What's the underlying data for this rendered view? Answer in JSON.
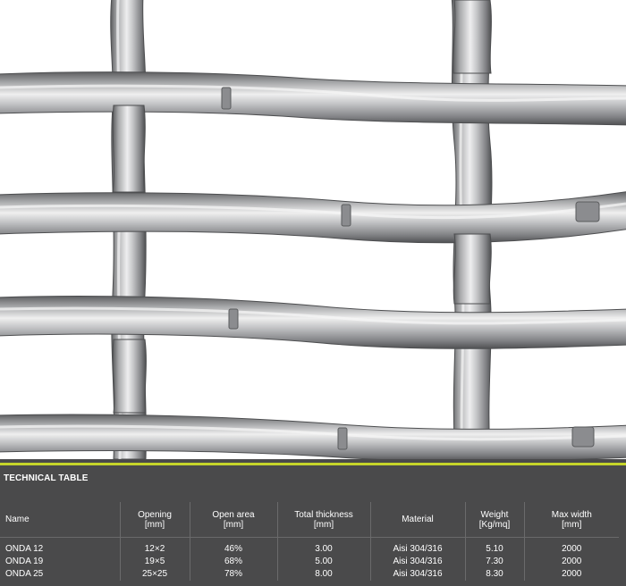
{
  "colors": {
    "panel_background": "#4a4a4b",
    "accent": "#c6d52a",
    "table_text": "#ffffff",
    "photo_background": "#ffffff",
    "wire_metal": "#b8b9bb"
  },
  "photo": {
    "subject": "crimped-wire-mesh-photo"
  },
  "table": {
    "title": "TECHNICAL TABLE",
    "headers": [
      {
        "label": "Name",
        "unit": ""
      },
      {
        "label": "Opening",
        "unit": "[mm]"
      },
      {
        "label": "Open area",
        "unit": "[mm]"
      },
      {
        "label": "Total thickness",
        "unit": "[mm]"
      },
      {
        "label": "Material",
        "unit": ""
      },
      {
        "label": "Weight",
        "unit": "[Kg/mq]"
      },
      {
        "label": "Max width",
        "unit": "[mm]"
      }
    ],
    "rows": [
      [
        "ONDA 12",
        "12×2",
        "46%",
        "3.00",
        "Aisi 304/316",
        "5.10",
        "2000"
      ],
      [
        "ONDA 19",
        "19×5",
        "68%",
        "5.00",
        "Aisi 304/316",
        "7.30",
        "2000"
      ],
      [
        "ONDA 25",
        "25×25",
        "78%",
        "8.00",
        "Aisi 304/316",
        "8.30",
        "2000"
      ]
    ]
  }
}
